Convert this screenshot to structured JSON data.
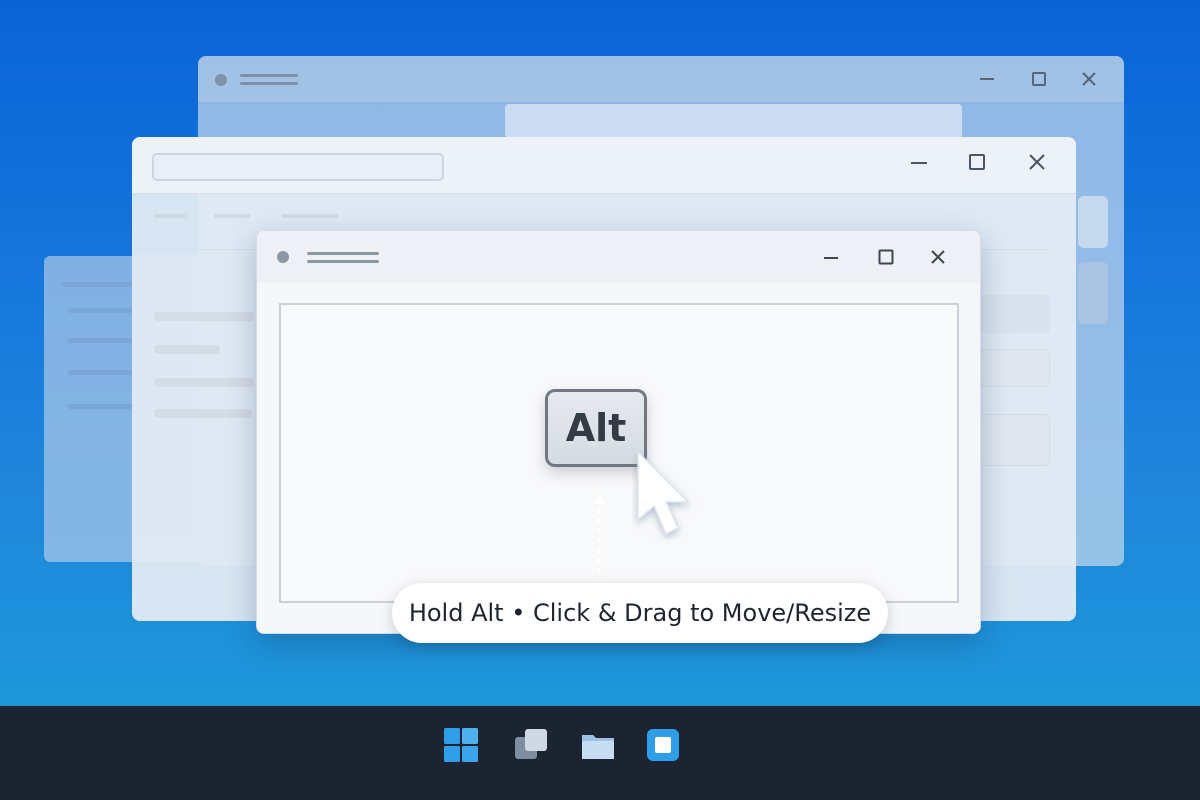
{
  "alt_key": {
    "label": "Alt"
  },
  "hint": {
    "text": "Hold Alt • Click & Drag to Move/Resize"
  },
  "windows": {
    "back": {
      "controls": [
        "minimize-icon",
        "maximize-icon",
        "close-icon"
      ]
    },
    "middle": {
      "controls": [
        "minimize-icon",
        "maximize-icon",
        "close-icon"
      ]
    },
    "front": {
      "controls": [
        "minimize-icon",
        "maximize-icon",
        "close-icon"
      ]
    }
  },
  "taskbar": {
    "icons": [
      "windows-start-icon",
      "task-view-icon",
      "file-explorer-icon",
      "app-icon"
    ]
  },
  "colors": {
    "desktop_top": "#0a63d6",
    "desktop_bottom": "#1f9ddb",
    "taskbar": "#1c2431",
    "accent": "#2f9de8"
  }
}
